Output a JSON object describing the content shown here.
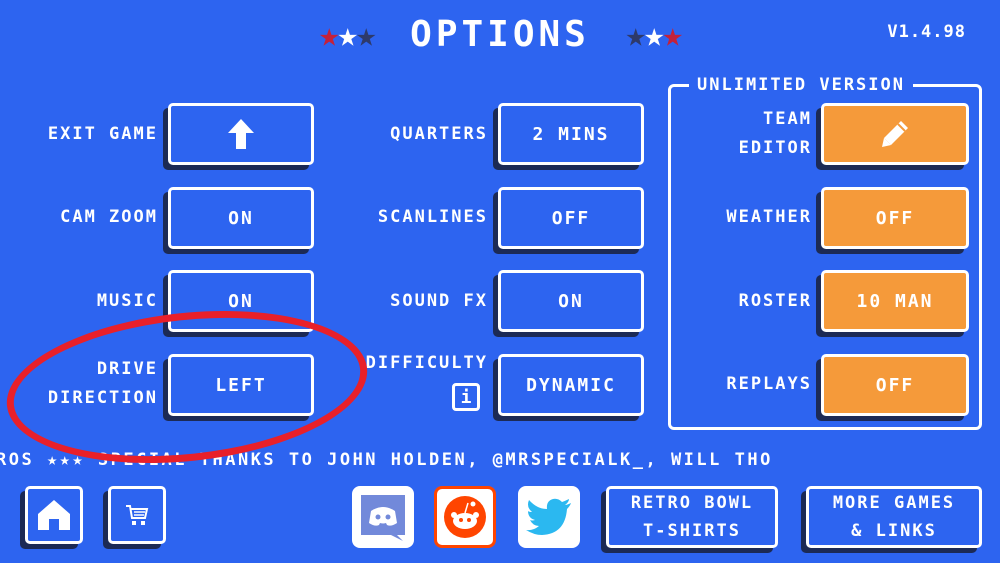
{
  "header": {
    "title": "OPTIONS",
    "stars_left": [
      "red",
      "white",
      "navy"
    ],
    "stars_right": [
      "navy",
      "white",
      "red"
    ],
    "star_glyph": "★",
    "version": "V1.4.98"
  },
  "colors": {
    "background": "#2d64f0",
    "button_border": "#ffffff",
    "button_shadow": "#1c2a55",
    "premium_button": "#f59a3a",
    "star_red": "#c4213a",
    "star_white": "#ffffff",
    "star_navy": "#2e3a6b",
    "annotation": "#e8202a"
  },
  "options": {
    "left": [
      {
        "label": "EXIT GAME",
        "value": "",
        "icon": "up-arrow-icon"
      },
      {
        "label": "CAM ZOOM",
        "value": "ON"
      },
      {
        "label": "MUSIC",
        "value": "ON"
      },
      {
        "label_line1": "DRIVE",
        "label_line2": "DIRECTION",
        "value": "LEFT"
      }
    ],
    "middle": [
      {
        "label": "QUARTERS",
        "value": "2 MINS"
      },
      {
        "label": "SCANLINES",
        "value": "OFF"
      },
      {
        "label": "SOUND FX",
        "value": "ON"
      },
      {
        "label": "DIFFICULTY",
        "value": "DYNAMIC",
        "info_icon": "i"
      }
    ]
  },
  "unlimited": {
    "title": "UNLIMITED VERSION",
    "items": [
      {
        "label_line1": "TEAM",
        "label_line2": "EDITOR",
        "value": "",
        "icon": "pencil-icon"
      },
      {
        "label": "WEATHER",
        "value": "OFF"
      },
      {
        "label": "ROSTER",
        "value": "10 MAN"
      },
      {
        "label": "REPLAYS",
        "value": "OFF"
      }
    ]
  },
  "ticker": {
    "text": "ROS     ★★★     SPECIAL THANKS TO JOHN HOLDEN, @MRSPECIALK_, WILL THO"
  },
  "footer": {
    "home_icon": "home-icon",
    "shop_icon": "cart-icon",
    "social": [
      "discord",
      "reddit",
      "twitter"
    ],
    "tshirts_line1": "RETRO BOWL",
    "tshirts_line2": "T-SHIRTS",
    "more_line1": "MORE GAMES",
    "more_line2": "& LINKS"
  }
}
